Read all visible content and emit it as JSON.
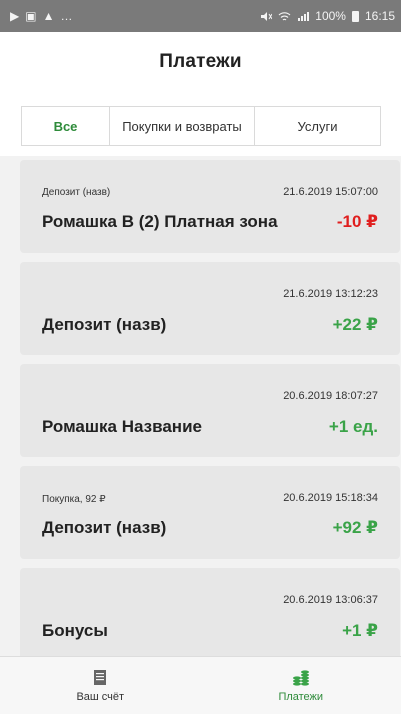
{
  "status_bar": {
    "left_icons": [
      "▶",
      "▣",
      "▲",
      "…"
    ],
    "right_text": "100%",
    "time": "16:15"
  },
  "header": {
    "title": "Платежи"
  },
  "tabs": [
    {
      "label": "Все",
      "active": true
    },
    {
      "label": "Покупки и возвраты",
      "active": false
    },
    {
      "label": "Услуги",
      "active": false
    }
  ],
  "payments": [
    {
      "subtitle": "Депозит (назв)",
      "date": "21.6.2019 15:07:00",
      "title": "Ромашка В (2) Платная зона",
      "amount": "-10 ₽",
      "type": "neg"
    },
    {
      "subtitle": "",
      "date": "21.6.2019 13:12:23",
      "title": "Депозит (назв)",
      "amount": "+22 ₽",
      "type": "pos"
    },
    {
      "subtitle": "",
      "date": "20.6.2019 18:07:27",
      "title": "Ромашка Название",
      "amount": "+1 ед.",
      "type": "pos"
    },
    {
      "subtitle": "Покупка, 92 ₽",
      "date": "20.6.2019 15:18:34",
      "title": "Депозит (назв)",
      "amount": "+92 ₽",
      "type": "pos"
    },
    {
      "subtitle": "",
      "date": "20.6.2019 13:06:37",
      "title": "Бонусы",
      "amount": "+1 ₽",
      "type": "pos"
    }
  ],
  "bottom_nav": [
    {
      "label": "Ваш счёт",
      "icon": "receipt-icon",
      "active": false
    },
    {
      "label": "Платежи",
      "icon": "coins-icon",
      "active": true
    }
  ],
  "colors": {
    "accent": "#2e8b3a",
    "negative": "#e01f1f",
    "positive": "#3aa348"
  }
}
